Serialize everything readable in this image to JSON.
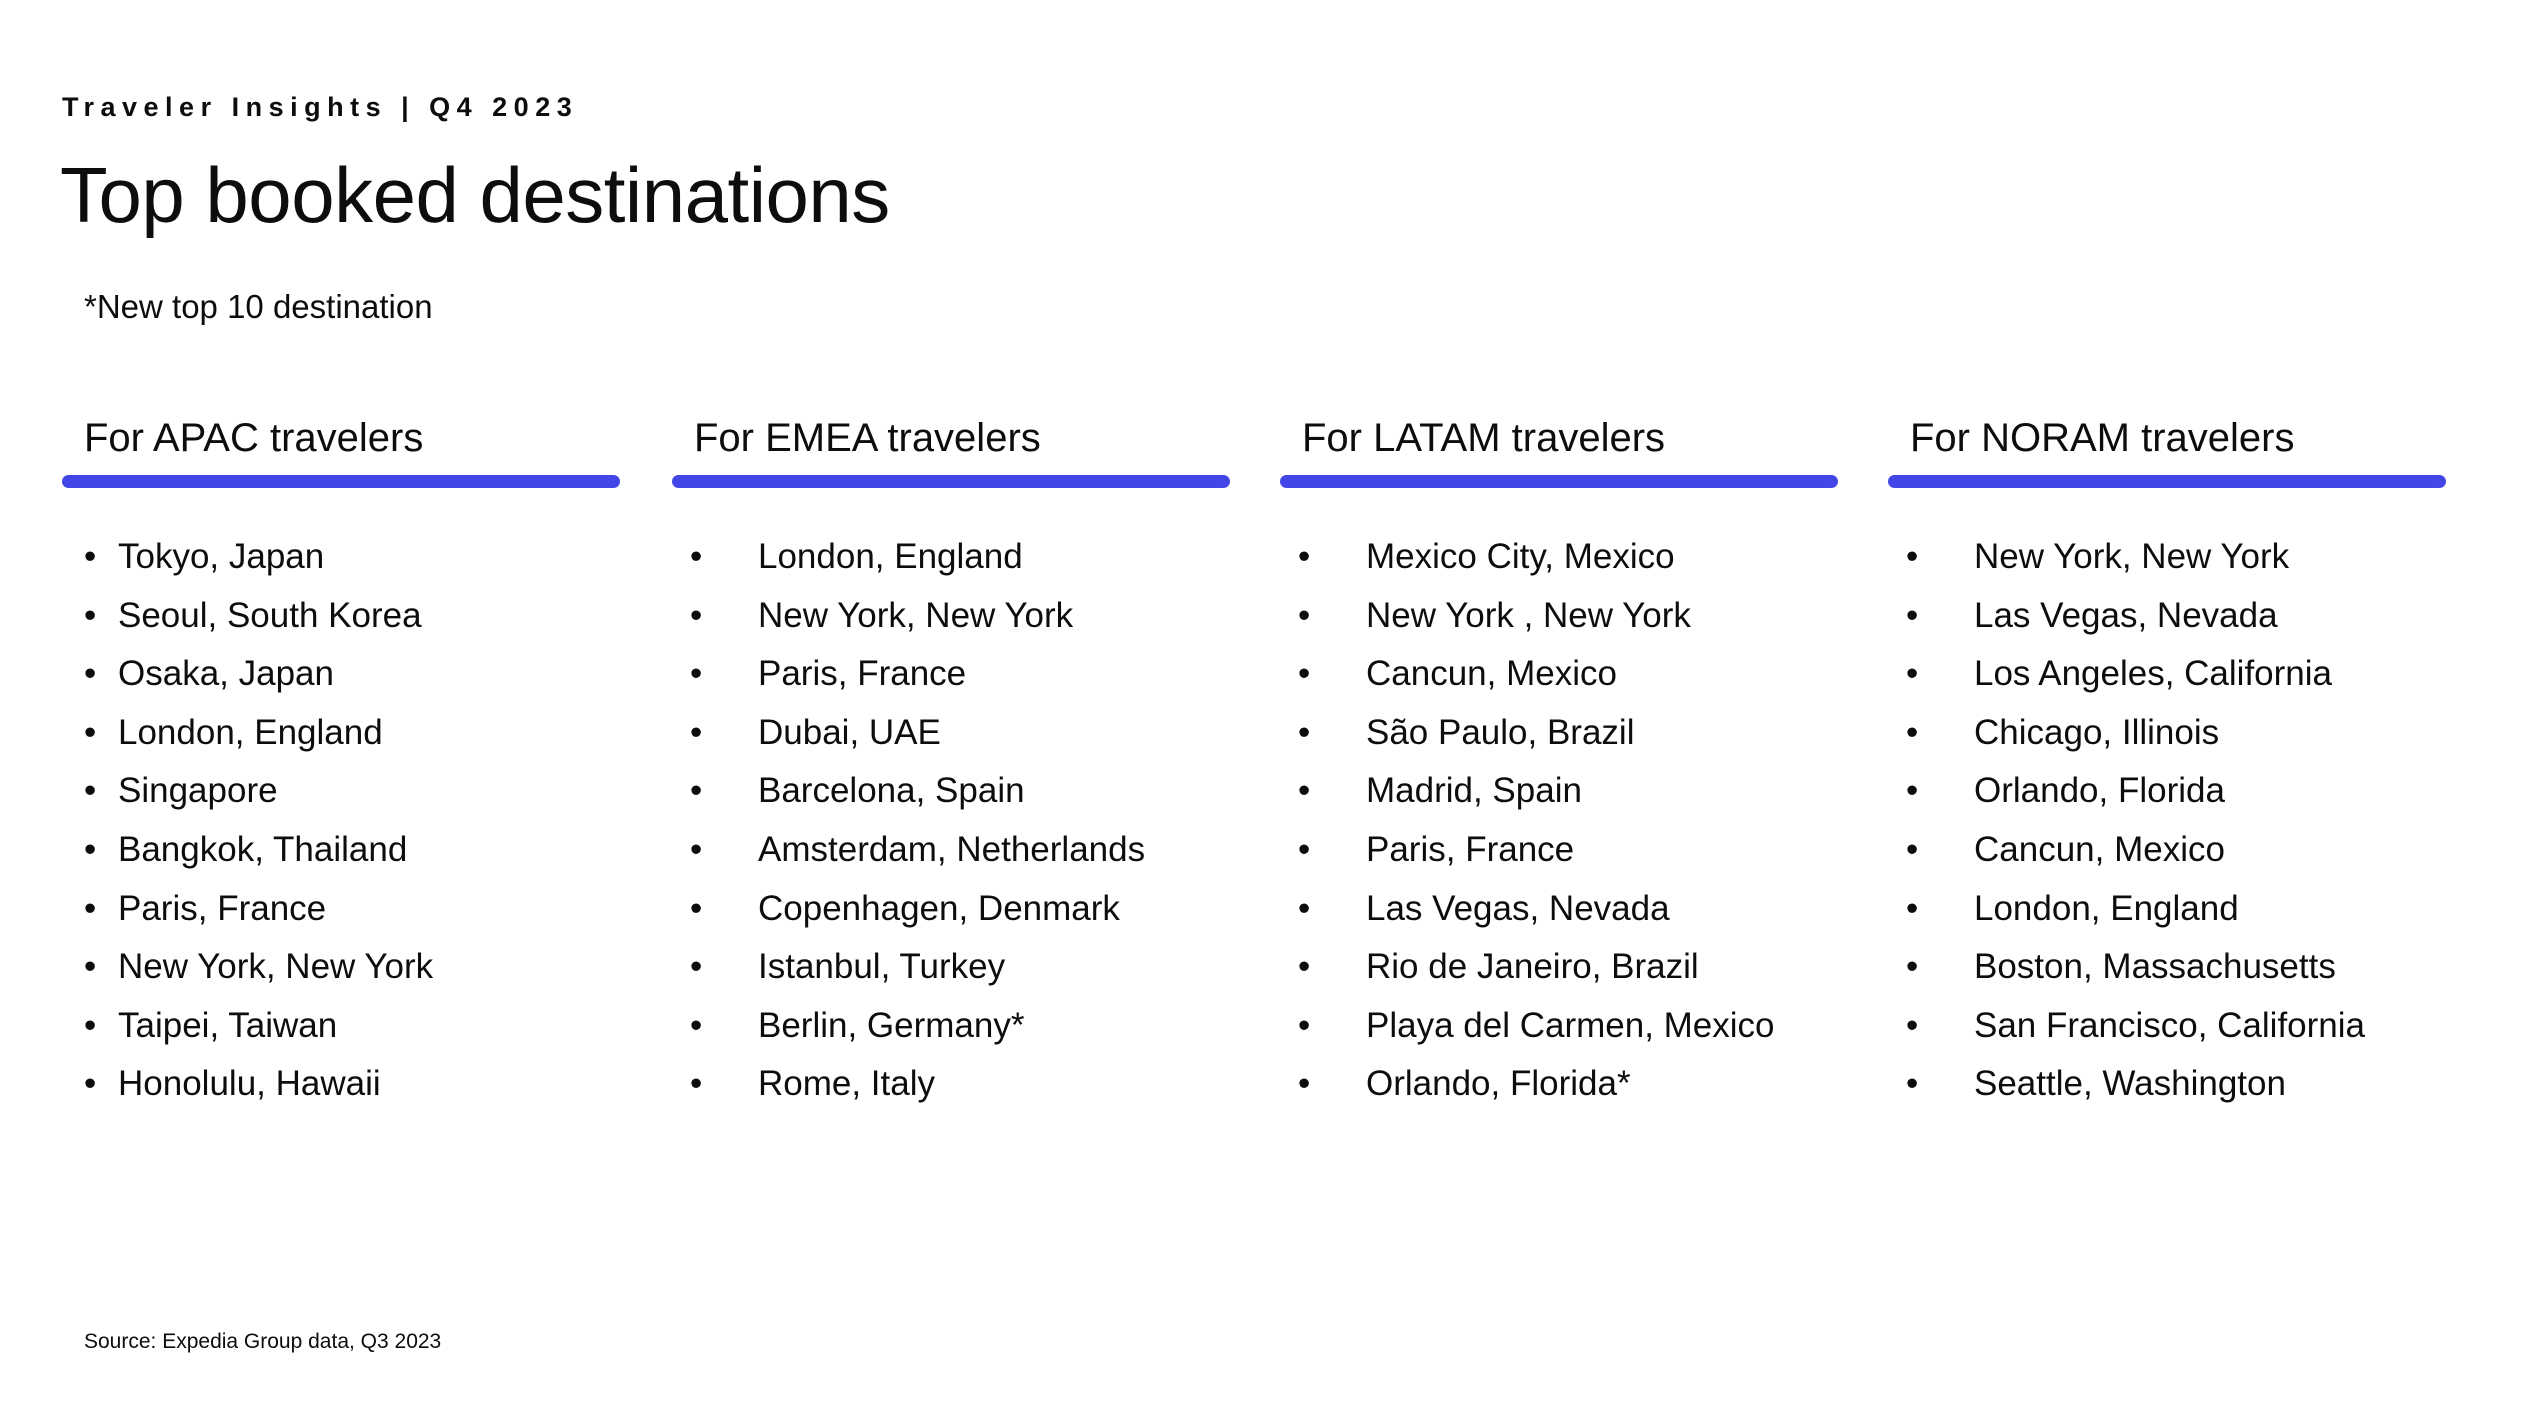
{
  "header": {
    "eyebrow": "Traveler Insights | Q4 2023",
    "title": "Top booked destinations",
    "note": "*New top 10 destination"
  },
  "theme": {
    "rule_color": "#4346e6",
    "text_color": "#0d0d0d",
    "background": "#ffffff"
  },
  "bullet_glyph": "•",
  "columns": [
    {
      "heading": "For APAC travelers",
      "items": [
        "Tokyo, Japan",
        "Seoul, South Korea",
        "Osaka, Japan",
        "London, England",
        "Singapore",
        "Bangkok, Thailand",
        "Paris, France",
        "New York, New York",
        "Taipei, Taiwan",
        "Honolulu, Hawaii"
      ]
    },
    {
      "heading": "For EMEA travelers",
      "items": [
        "London, England",
        "New York, New York",
        "Paris, France",
        "Dubai, UAE",
        "Barcelona, Spain",
        "Amsterdam, Netherlands",
        "Copenhagen, Denmark",
        "Istanbul, Turkey",
        "Berlin, Germany*",
        "Rome, Italy"
      ]
    },
    {
      "heading": "For LATAM travelers",
      "items": [
        "Mexico City, Mexico",
        "New York , New York",
        "Cancun, Mexico",
        "São Paulo, Brazil",
        "Madrid, Spain",
        "Paris, France",
        "Las Vegas, Nevada",
        "Rio de Janeiro, Brazil",
        "Playa del Carmen, Mexico",
        "Orlando, Florida*"
      ]
    },
    {
      "heading": "For NORAM travelers",
      "items": [
        "New York, New York",
        "Las Vegas, Nevada",
        "Los Angeles, California",
        "Chicago, Illinois",
        "Orlando, Florida",
        "Cancun, Mexico",
        "London, England",
        "Boston, Massachusetts",
        "San Francisco, California",
        "Seattle, Washington"
      ]
    }
  ],
  "footer": {
    "source": "Source: Expedia Group data, Q3 2023"
  }
}
